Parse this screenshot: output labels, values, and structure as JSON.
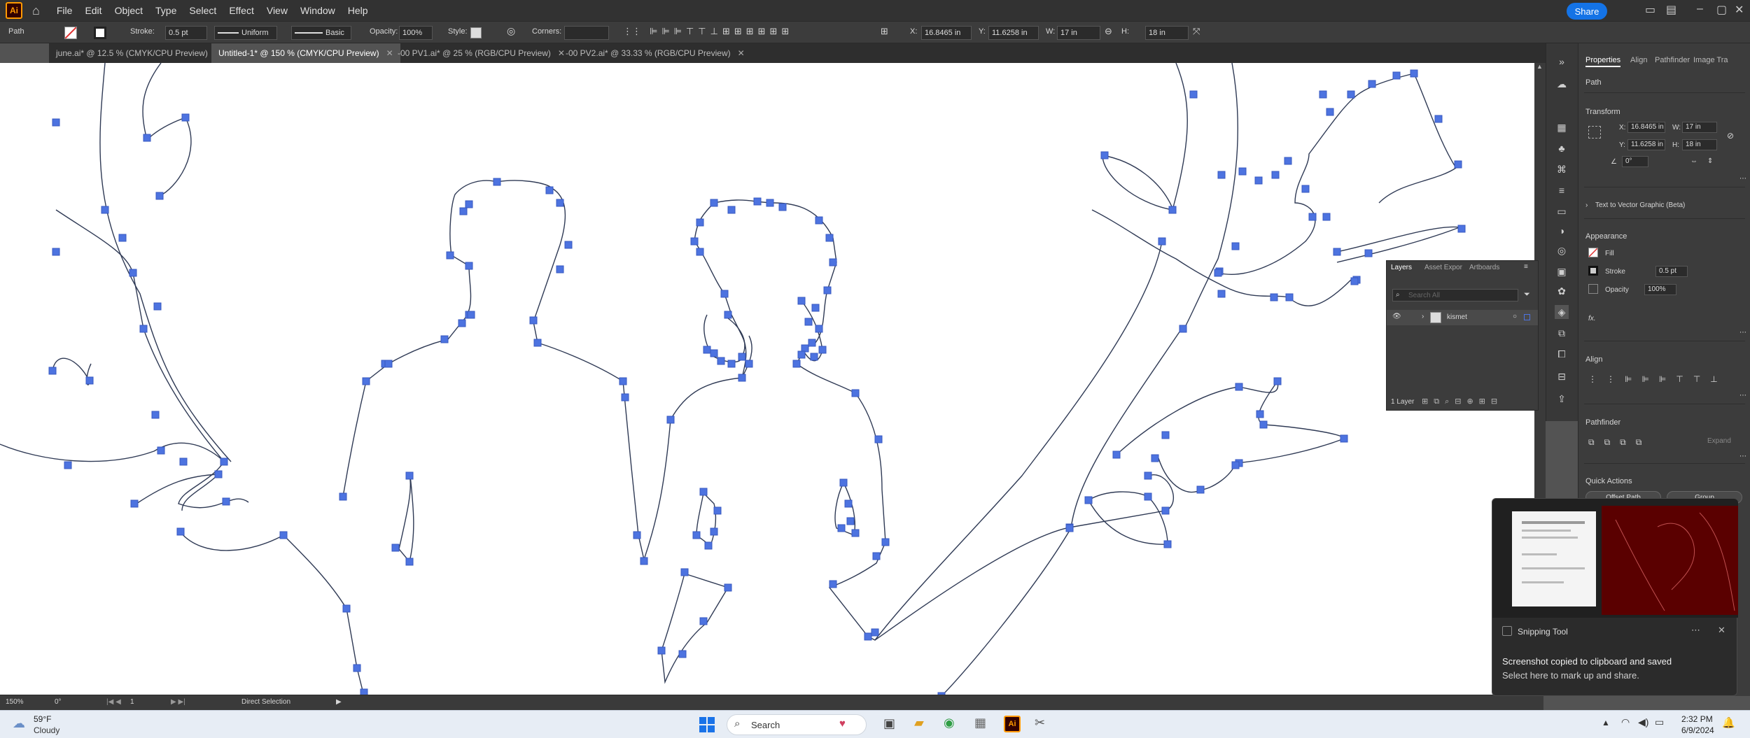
{
  "menubar": {
    "app_logo": "Ai",
    "items": [
      "File",
      "Edit",
      "Object",
      "Type",
      "Select",
      "Effect",
      "View",
      "Window",
      "Help"
    ],
    "share_label": "Share"
  },
  "control_bar": {
    "selection_type": "Path",
    "stroke_label": "Stroke:",
    "stroke_value": "0.5 pt",
    "stroke_profile": "Uniform",
    "brush": "Basic",
    "opacity_label": "Opacity:",
    "opacity_value": "100%",
    "style_label": "Style:",
    "corners_label": "Corners:",
    "x_label": "X:",
    "x_value": "16.8465 in",
    "y_label": "Y:",
    "y_value": "11.6258 in",
    "w_label": "W:",
    "w_value": "17 in",
    "h_label": "H:",
    "h_value": "18 in"
  },
  "tabs": [
    {
      "label": "june.ai* @ 12.5 % (CMYK/CPU Preview)",
      "active": false
    },
    {
      "label": "Untitled-1* @ 150 % (CMYK/CPU Preview)",
      "active": true
    },
    {
      "label": "-00 PV1.ai* @ 25 % (RGB/CPU Preview)",
      "active": false
    },
    {
      "label": "-00 PV2.ai* @ 33.33 % (RGB/CPU Preview)",
      "active": false
    }
  ],
  "status_bar": {
    "zoom": "150%",
    "rotation": "0°",
    "artboard": "1",
    "tool_name": "Direct Selection"
  },
  "properties_panel": {
    "tabs": [
      "Properties",
      "Align",
      "Pathfinder",
      "Image Tra"
    ],
    "object_type": "Path",
    "transform_title": "Transform",
    "x_value": "16.8465 in",
    "y_value": "11.6258 in",
    "w_value": "17 in",
    "h_value": "18 in",
    "angle_value": "0°",
    "text_to_vector": "Text to Vector Graphic (Beta)",
    "appearance_title": "Appearance",
    "fill_label": "Fill",
    "stroke_label": "Stroke",
    "stroke_value": "0.5 pt",
    "opacity_label": "Opacity",
    "opacity_value": "100%",
    "fx_label": "fx.",
    "align_title": "Align",
    "pathfinder_title": "Pathfinder",
    "expand_label": "Expand",
    "quick_actions_title": "Quick Actions",
    "offset_path": "Offset Path",
    "group": "Group"
  },
  "layers_panel": {
    "tabs": [
      "Layers",
      "Asset Expor",
      "Artboards"
    ],
    "search_placeholder": "Search All",
    "layer_name": "kismet",
    "layer_count": "1 Layer"
  },
  "notification": {
    "app_name": "Snipping Tool",
    "title": "Screenshot copied to clipboard and saved",
    "subtitle": "Select here to mark up and share."
  },
  "taskbar": {
    "weather_temp": "59°F",
    "weather_cond": "Cloudy",
    "search_placeholder": "Search",
    "time": "2:32 PM",
    "date": "6/9/2024"
  },
  "colors": {
    "anchor": "#4d73e0",
    "path": "#3a4a6a",
    "accent": "#1473e6"
  }
}
